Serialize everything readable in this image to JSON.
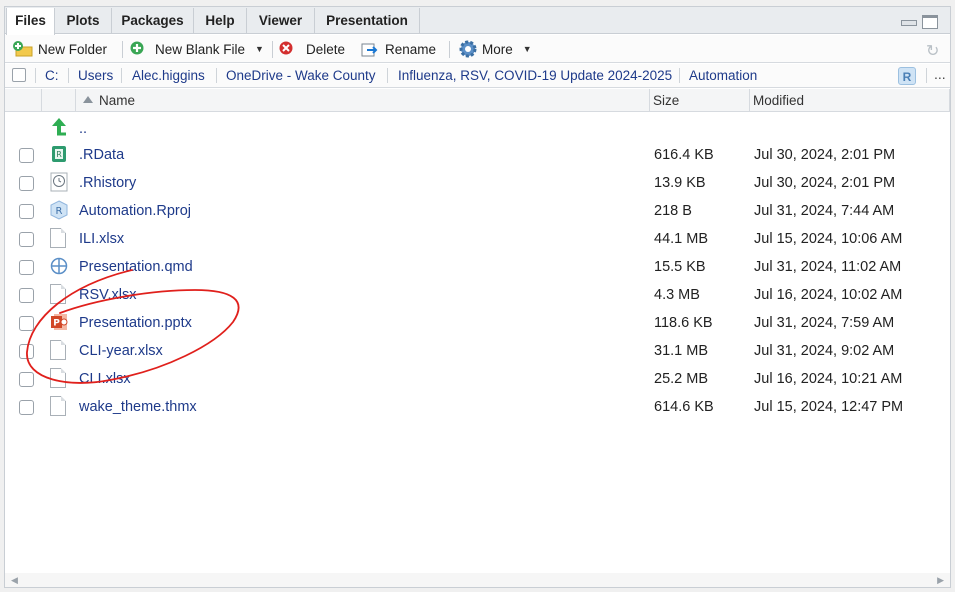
{
  "tabs": [
    {
      "label": "Files",
      "active": true
    },
    {
      "label": "Plots"
    },
    {
      "label": "Packages"
    },
    {
      "label": "Help"
    },
    {
      "label": "Viewer"
    },
    {
      "label": "Presentation"
    }
  ],
  "toolbar": {
    "new_folder": "New Folder",
    "new_blank_file": "New Blank File",
    "delete": "Delete",
    "rename": "Rename",
    "more": "More"
  },
  "breadcrumb": [
    "C:",
    "Users",
    "Alec.higgins",
    "OneDrive - Wake County",
    "Influenza, RSV, COVID-19 Update 2024-2025",
    "Automation"
  ],
  "breadcrumb_more": "...",
  "columns": {
    "name": "Name",
    "size": "Size",
    "modified": "Modified"
  },
  "parent_dir": "..",
  "files": [
    {
      "name": ".RData",
      "size": "616.4 KB",
      "modified": "Jul 30, 2024, 2:01 PM",
      "icon": "rdata-icon"
    },
    {
      "name": ".Rhistory",
      "size": "13.9 KB",
      "modified": "Jul 30, 2024, 2:01 PM",
      "icon": "history-icon"
    },
    {
      "name": "Automation.Rproj",
      "size": "218 B",
      "modified": "Jul 31, 2024, 7:44 AM",
      "icon": "rproj-icon"
    },
    {
      "name": "ILI.xlsx",
      "size": "44.1 MB",
      "modified": "Jul 15, 2024, 10:06 AM",
      "icon": "file-icon"
    },
    {
      "name": "Presentation.qmd",
      "size": "15.5 KB",
      "modified": "Jul 31, 2024, 11:02 AM",
      "icon": "quarto-icon"
    },
    {
      "name": "RSV.xlsx",
      "size": "4.3 MB",
      "modified": "Jul 16, 2024, 10:02 AM",
      "icon": "file-icon"
    },
    {
      "name": "Presentation.pptx",
      "size": "118.6 KB",
      "modified": "Jul 31, 2024, 7:59 AM",
      "icon": "powerpoint-icon"
    },
    {
      "name": "CLI-year.xlsx",
      "size": "31.1 MB",
      "modified": "Jul 31, 2024, 9:02 AM",
      "icon": "file-icon"
    },
    {
      "name": "CLI.xlsx",
      "size": "25.2 MB",
      "modified": "Jul 16, 2024, 10:21 AM",
      "icon": "file-icon"
    },
    {
      "name": "wake_theme.thmx",
      "size": "614.6 KB",
      "modified": "Jul 15, 2024, 12:47 PM",
      "icon": "file-icon"
    }
  ],
  "colors": {
    "link": "#1e3a8a",
    "annotation": "#e0201c"
  }
}
